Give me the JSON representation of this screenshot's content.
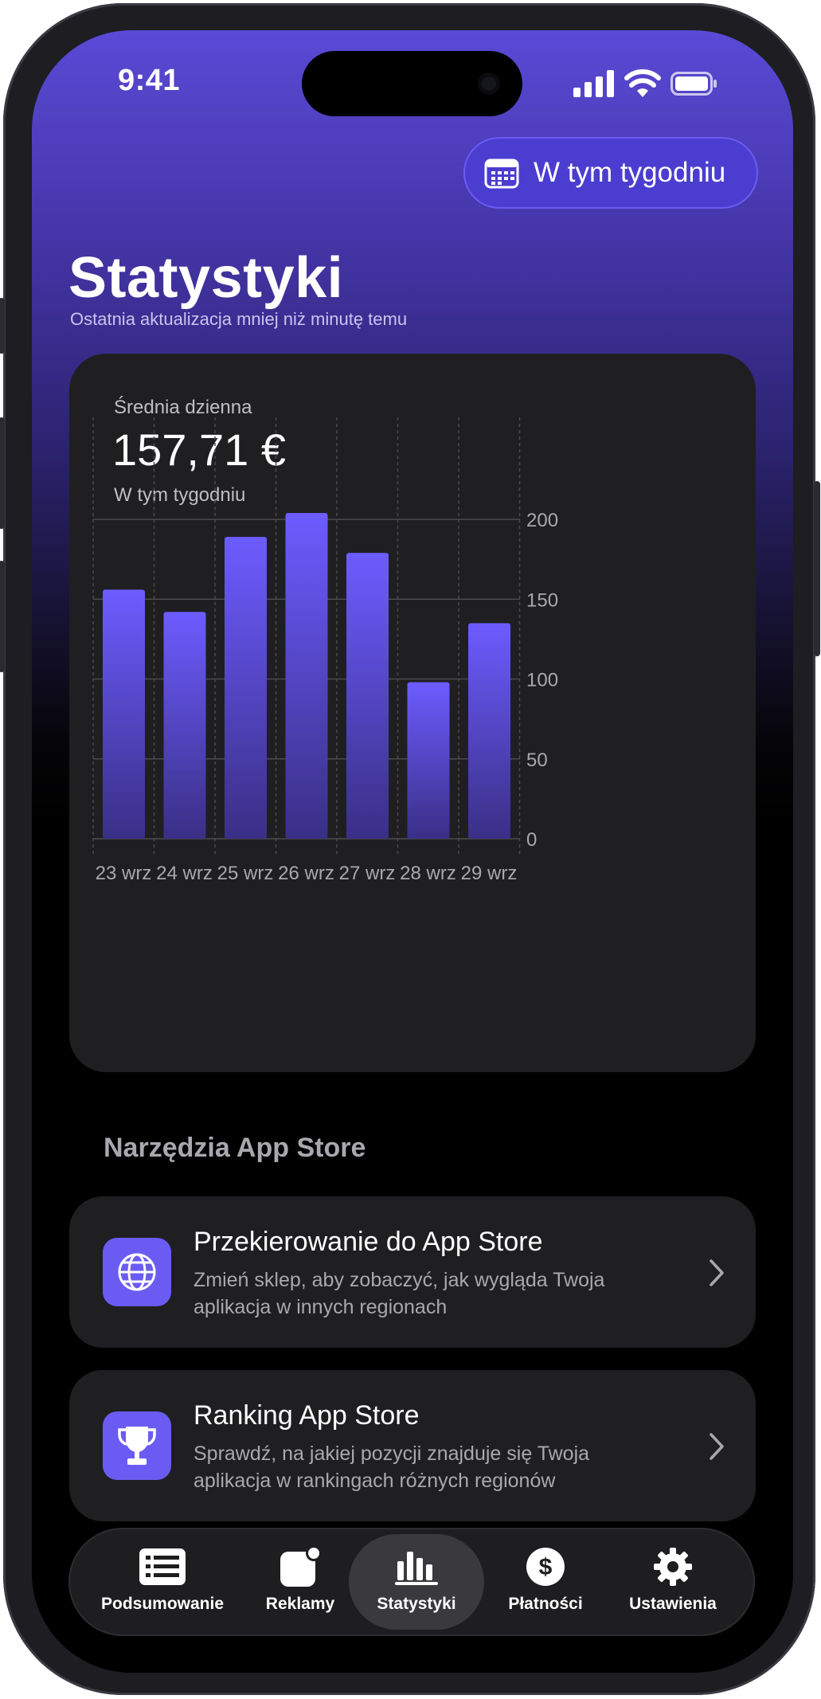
{
  "status_bar": {
    "time": "9:41"
  },
  "period_button": {
    "label": "W tym tygodniu",
    "icon": "calendar-icon"
  },
  "header": {
    "title": "Statystyki",
    "subtitle": "Ostatnia aktualizacja mniej niż minutę temu"
  },
  "summary": {
    "label": "Średnia dzienna",
    "value": "157,71 €",
    "period": "W tym tygodniu"
  },
  "chart_data": {
    "type": "bar",
    "categories": [
      "23 wrz",
      "24 wrz",
      "25 wrz",
      "26 wrz",
      "27 wrz",
      "28 wrz",
      "29 wrz"
    ],
    "values": [
      156,
      142,
      189,
      204,
      179,
      98,
      135
    ],
    "ylim": [
      0,
      200
    ],
    "yticks": [
      0,
      50,
      100,
      150,
      200
    ],
    "grid": true,
    "y_axis_position": "right",
    "bar_color_top": "#6c5cff",
    "bar_color_bottom": "#3a2f86"
  },
  "tools": {
    "heading": "Narzędzia App Store",
    "items": [
      {
        "title": "Przekierowanie do App Store",
        "description": "Zmień sklep, aby zobaczyć, jak wygląda Twoja aplikacja w innych regionach",
        "icon": "globe-icon"
      },
      {
        "title": "Ranking App Store",
        "description": "Sprawdź, na jakiej pozycji znajduje się Twoja aplikacja w rankingach różnych regionów",
        "icon": "trophy-icon"
      }
    ]
  },
  "tabbar": {
    "active": "Statystyki",
    "items": [
      {
        "label": "Podsumowanie",
        "icon": "list-icon"
      },
      {
        "label": "Reklamy",
        "icon": "ads-badge-icon"
      },
      {
        "label": "Statystyki",
        "icon": "bar-chart-icon"
      },
      {
        "label": "Płatności",
        "icon": "dollar-icon"
      },
      {
        "label": "Ustawienia",
        "icon": "gear-icon"
      }
    ]
  },
  "colors": {
    "accent": "#6a5cf2",
    "card": "#1f1f21",
    "header_gradient_top": "#5a4ad6"
  }
}
